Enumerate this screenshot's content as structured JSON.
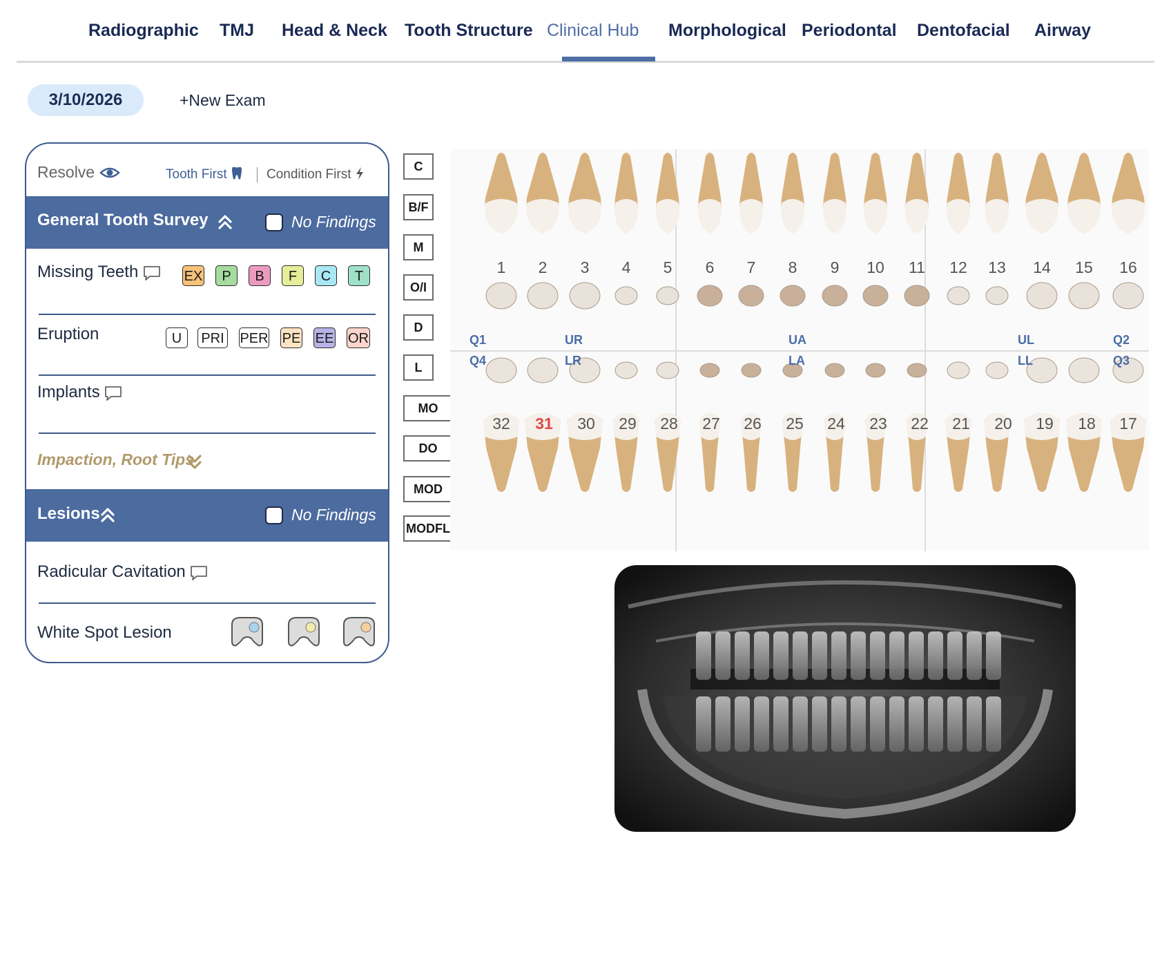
{
  "nav": {
    "tabs": [
      "Radiographic",
      "TMJ",
      "Head & Neck",
      "Tooth Structure",
      "Clinical Hub",
      "Morphological",
      "Periodontal",
      "Dentofacial",
      "Airway"
    ],
    "active": "Clinical Hub"
  },
  "exam": {
    "date": "3/10/2026",
    "new_exam": "+New Exam"
  },
  "panel": {
    "resolve": "Resolve",
    "tooth_first": "Tooth First",
    "condition_first": "Condition First",
    "general": {
      "title": "General Tooth Survey",
      "no_findings": "No Findings",
      "missing_teeth": {
        "label": "Missing Teeth",
        "chips": [
          "EX",
          "P",
          "B",
          "F",
          "C",
          "T"
        ]
      },
      "eruption": {
        "label": "Eruption",
        "chips": [
          "U",
          "PRI",
          "PER",
          "PE",
          "EE",
          "OR"
        ]
      },
      "implants": "Implants",
      "impaction": "Impaction, Root Tips"
    },
    "lesions": {
      "title": "Lesions",
      "no_findings": "No Findings",
      "radicular": "Radicular Cavitation",
      "white_spot": "White Spot Lesion"
    }
  },
  "surfaces": [
    "C",
    "B/F",
    "M",
    "O/I",
    "D",
    "L",
    "MO",
    "DO",
    "MOD",
    "MODFL"
  ],
  "chart": {
    "upper_numbers": [
      "1",
      "2",
      "3",
      "4",
      "5",
      "6",
      "7",
      "8",
      "9",
      "10",
      "11",
      "12",
      "13",
      "14",
      "15",
      "16"
    ],
    "lower_numbers": [
      "32",
      "31",
      "30",
      "29",
      "28",
      "27",
      "26",
      "25",
      "24",
      "23",
      "22",
      "21",
      "20",
      "19",
      "18",
      "17"
    ],
    "flagged_tooth": "31",
    "upper_labels": {
      "q1": "Q1",
      "ur": "UR",
      "ua": "UA",
      "ul": "UL",
      "q2": "Q2"
    },
    "lower_labels": {
      "q4": "Q4",
      "lr": "LR",
      "la": "LA",
      "ll": "LL",
      "q3": "Q3"
    }
  },
  "colors": {
    "nav_active": "#4e6ea6",
    "section_header": "#4c6b9f",
    "flag": "#e0484a",
    "chip_ex": "#f6c27a",
    "chip_p": "#a6dca0",
    "chip_b": "#ec9bc0",
    "chip_f": "#e7ee9a",
    "chip_c": "#a9e7f4",
    "chip_t": "#9fe0c8",
    "chip_pe": "#fde3c1",
    "chip_ee": "#b7b3e6",
    "chip_or": "#fbd5cd"
  },
  "icons": [
    "eye-icon",
    "tooth-icon",
    "lightning-icon",
    "chevrons-up-icon",
    "chevrons-down-icon",
    "comment-icon",
    "white-spot-tooth-icon"
  ]
}
